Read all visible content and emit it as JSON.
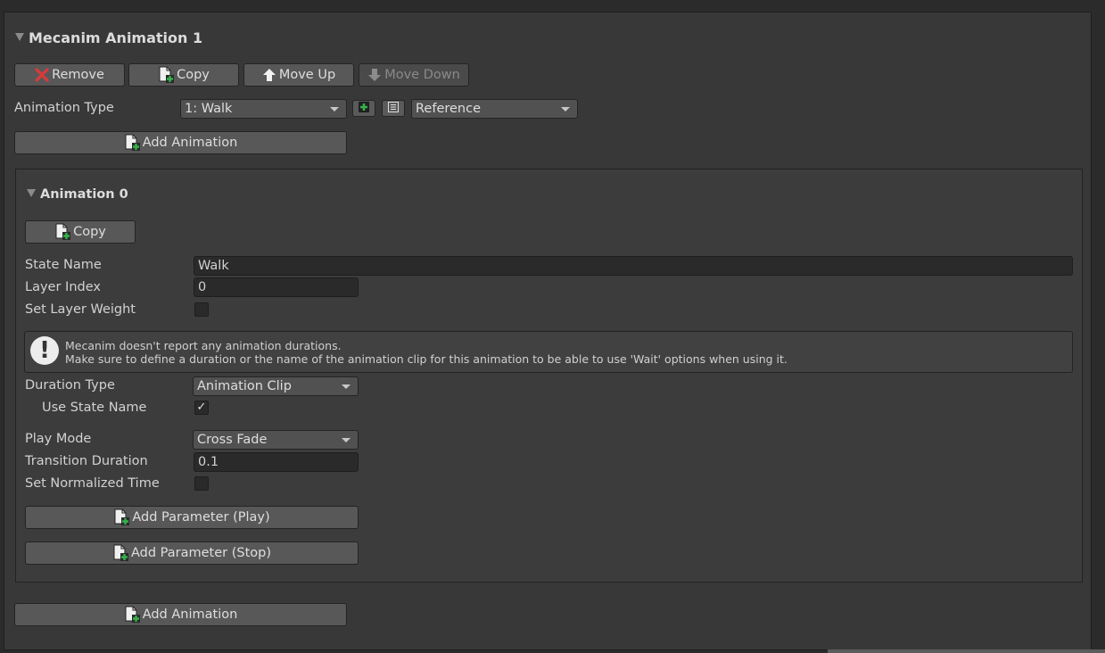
{
  "header": {
    "title": "Mecanim Animation 1"
  },
  "toolbar": {
    "remove": "Remove",
    "copy": "Copy",
    "move_up": "Move Up",
    "move_down": "Move Down"
  },
  "animation_type": {
    "label": "Animation Type",
    "value": "1: Walk",
    "reference_value": "Reference"
  },
  "add_animation": "Add Animation",
  "animation": {
    "title": "Animation 0",
    "copy": "Copy",
    "state_name": {
      "label": "State Name",
      "value": "Walk"
    },
    "layer_index": {
      "label": "Layer Index",
      "value": "0"
    },
    "set_layer_weight": {
      "label": "Set Layer Weight",
      "checked": false
    },
    "help": {
      "line1": "Mecanim doesn't report any animation durations.",
      "line2": "Make sure to define a duration or the name of the animation clip for this animation to be able to use 'Wait' options when using it."
    },
    "duration_type": {
      "label": "Duration Type",
      "value": "Animation Clip"
    },
    "use_state_name": {
      "label": "Use State Name",
      "checked": true,
      "mark": "✓"
    },
    "play_mode": {
      "label": "Play Mode",
      "value": "Cross Fade"
    },
    "transition_duration": {
      "label": "Transition Duration",
      "value": "0.1"
    },
    "set_normalized_time": {
      "label": "Set Normalized Time",
      "checked": false
    },
    "add_param_play": "Add Parameter (Play)",
    "add_param_stop": "Add Parameter (Stop)"
  },
  "add_animation_bottom": "Add Animation",
  "icons": {
    "remove": "x-icon",
    "copy": "document-add-icon",
    "move_up": "arrow-up-icon",
    "move_down": "arrow-down-icon",
    "add": "plus-icon",
    "list": "list-icon",
    "warning": "warning-icon"
  },
  "colors": {
    "remove_icon": "#d93a3a",
    "add_icon": "#34b24a"
  }
}
